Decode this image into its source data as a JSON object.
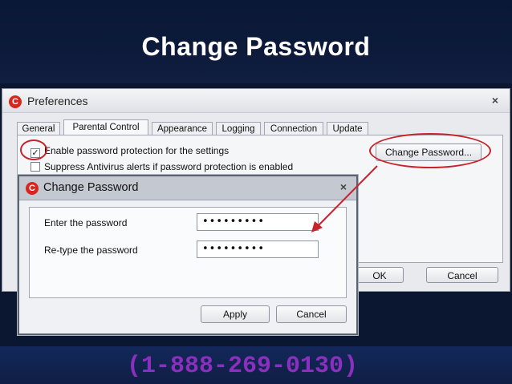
{
  "slide": {
    "title": "Change Password",
    "phone": "(1-888-269-0130)"
  },
  "prefs": {
    "title": "Preferences",
    "close": "×",
    "app_icon": "C",
    "tabs": [
      "General",
      "Parental Control",
      "Appearance",
      "Logging",
      "Connection",
      "Update"
    ],
    "active_tab": "Parental Control",
    "enable_label": "Enable password protection for the settings",
    "enable_checked": true,
    "suppress_label": "Suppress Antivirus alerts if password protection is enabled",
    "suppress_checked": false,
    "change_password_button": "Change Password...",
    "ok_button": "OK",
    "cancel_button": "Cancel"
  },
  "dialog": {
    "title": "Change Password",
    "close": "×",
    "app_icon": "C",
    "enter_label": "Enter the password",
    "enter_value": "•••••••••",
    "retype_label": "Re-type the password",
    "retype_value": "•••••••••",
    "apply_button": "Apply",
    "cancel_button": "Cancel"
  },
  "colors": {
    "annotation": "#c8232c",
    "phone_text": "#8b2fbf",
    "brand_icon": "#d8261f"
  }
}
